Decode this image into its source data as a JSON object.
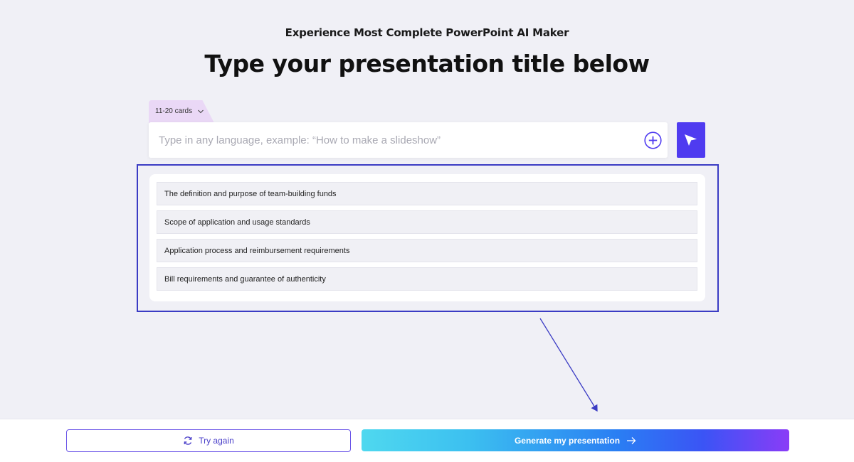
{
  "header": {
    "subtitle": "Experience Most Complete PowerPoint AI Maker",
    "title": "Type your presentation title below"
  },
  "cards_selector": {
    "label": "11-20 cards",
    "icon": "chevron-down-icon"
  },
  "search": {
    "placeholder": "Type in any language, example: “How to make a slideshow”",
    "value": "",
    "add_icon": "plus-circle-icon",
    "send_icon": "paper-plane-icon"
  },
  "outline": {
    "items": [
      "The definition and purpose of team-building funds",
      "Scope of application and usage standards",
      "Application process and reimbursement requirements",
      "Bill requirements and guarantee of authenticity"
    ]
  },
  "footer": {
    "try_again_label": "Try again",
    "try_again_icon": "refresh-icon",
    "generate_label": "Generate my presentation",
    "generate_icon": "arrow-right-icon"
  },
  "colors": {
    "accent": "#4f3bf0",
    "highlight_frame": "#3b3cc4",
    "tab_bg": "#ead8f6",
    "page_bg": "#f0f0f6"
  }
}
